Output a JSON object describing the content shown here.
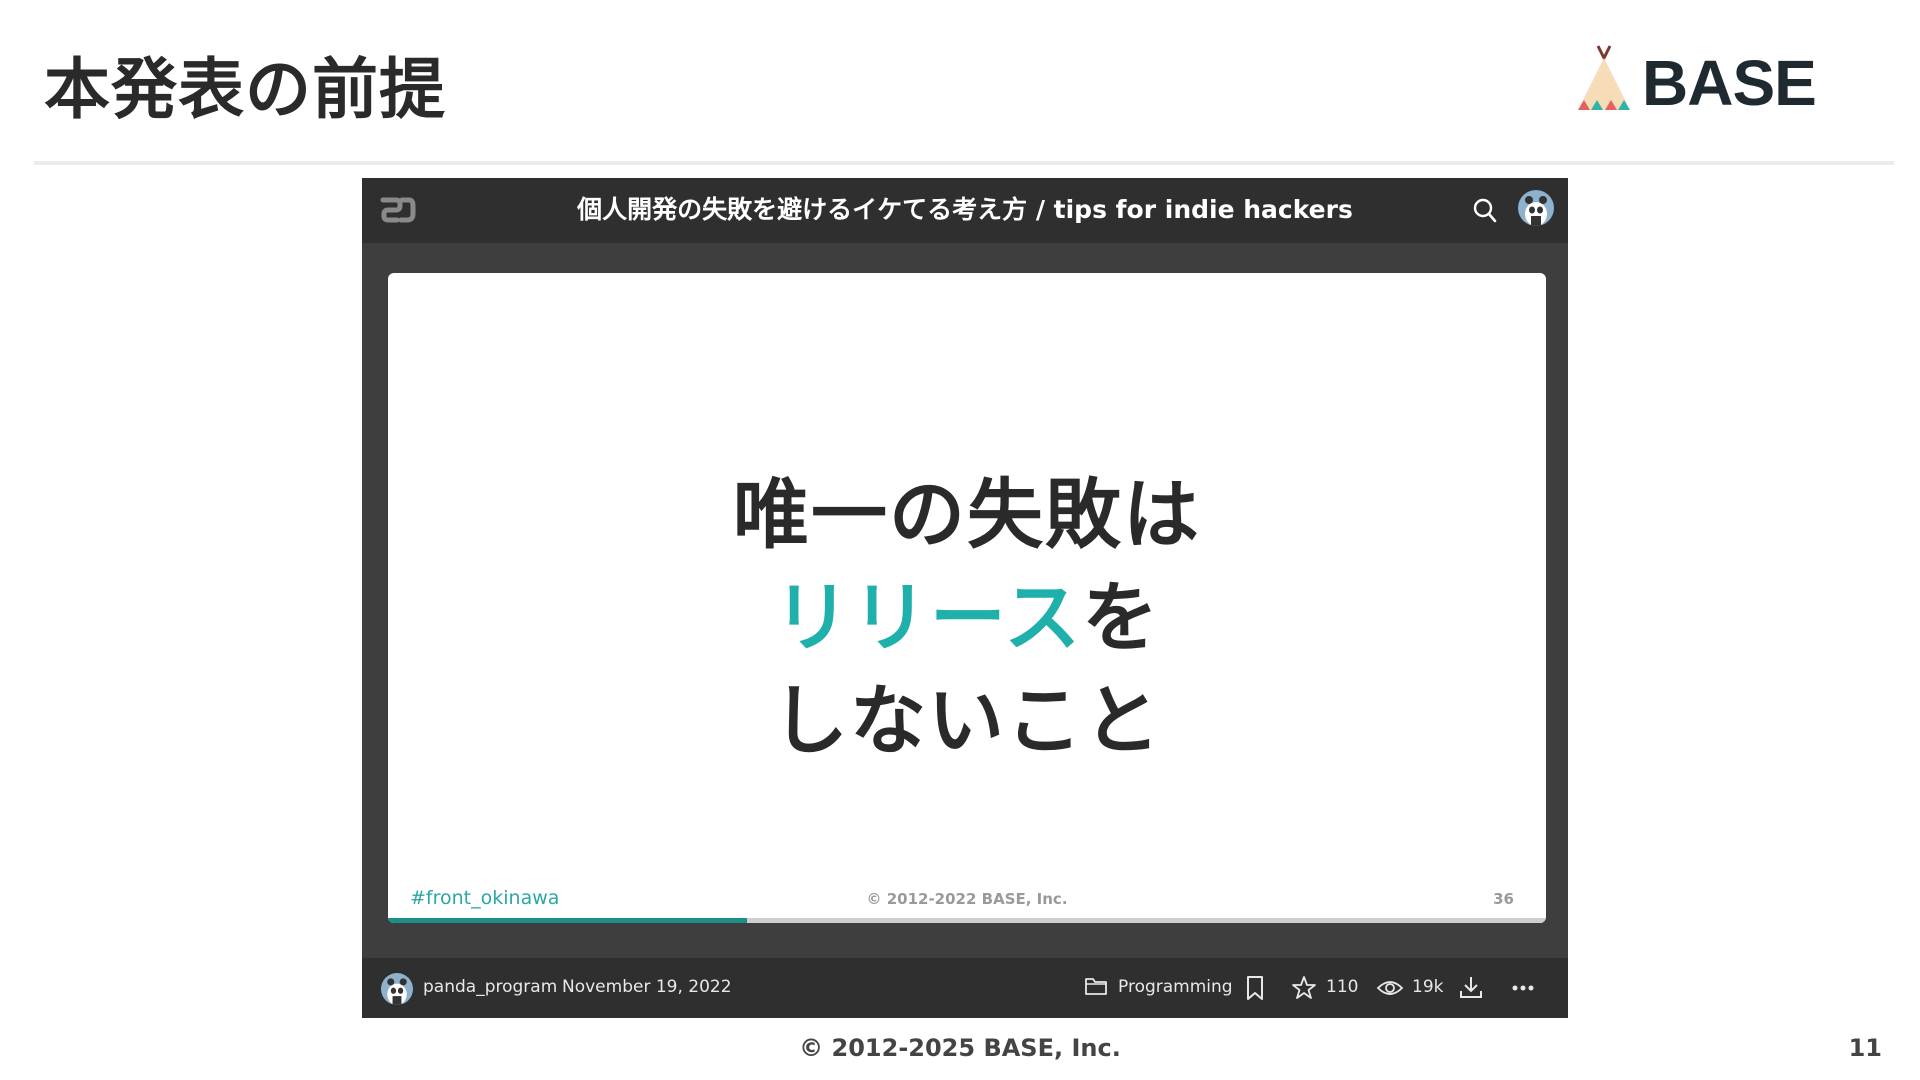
{
  "slide": {
    "title": "本発表の前提",
    "logo_text": "BASE",
    "footer_copyright": "© 2012-2025 BASE, Inc.",
    "page_number": "11"
  },
  "embed": {
    "header": {
      "deck_title": "個人開発の失敗を避けるイケてる考え方 / tips for indie hackers"
    },
    "inner_slide": {
      "line1": "唯一の失敗は",
      "line2_accent": "リリース",
      "line2_rest": "を",
      "line3": "しないこと",
      "hashtag": "#front_okinawa",
      "copyright": "© 2012-2022 BASE, Inc.",
      "page_number": "36",
      "progress_fraction": 0.31
    },
    "footer": {
      "author": "panda_program",
      "date": "November 19, 2022",
      "category": "Programming",
      "stars": "110",
      "views": "19k"
    }
  },
  "colors": {
    "accent_teal": "#1fb0ab",
    "progress_teal": "#1a8f8a",
    "embed_bg": "#3e3e3e",
    "bar_bg": "#2f2f2f"
  },
  "icons": [
    "speakerdeck-logo-icon",
    "search-icon",
    "avatar",
    "folder-icon",
    "bookmark-icon",
    "star-icon",
    "eye-icon",
    "download-icon",
    "more-icon",
    "teepee-logo-icon"
  ]
}
